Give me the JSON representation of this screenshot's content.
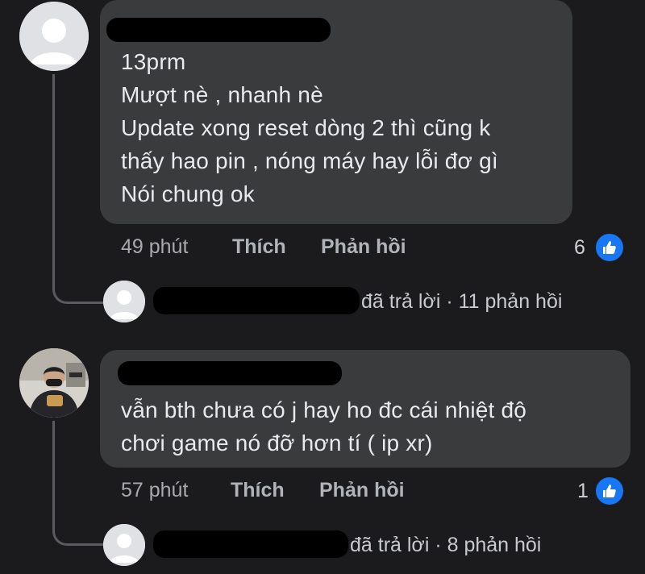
{
  "comment1": {
    "lines": [
      "13prm",
      "Mượt nè , nhanh nè",
      "Update xong reset dòng 2 thì cũng k",
      "thấy hao pin , nóng máy hay lỗi đơ gì",
      "Nói chung ok"
    ],
    "time": "49 phút",
    "like_label": "Thích",
    "reply_label": "Phản hồi",
    "reaction_count": "6",
    "reply_summary": "đã trả lời · 11 phản hồi"
  },
  "comment2": {
    "lines": [
      "vẫn bth chưa có j hay ho đc cái nhiệt độ",
      "chơi game nó đỡ hơn tí ( ip xr)"
    ],
    "time": "57 phút",
    "like_label": "Thích",
    "reply_label": "Phản hồi",
    "reaction_count": "1",
    "reply_summary": "đã trả lời · 8 phản hồi"
  },
  "colors": {
    "background": "#1b1b1d",
    "bubble": "#3a3b3d",
    "like_blue": "#1877f2"
  },
  "icons": {
    "avatar_default": "default-avatar-icon",
    "like": "thumbs-up-icon"
  }
}
